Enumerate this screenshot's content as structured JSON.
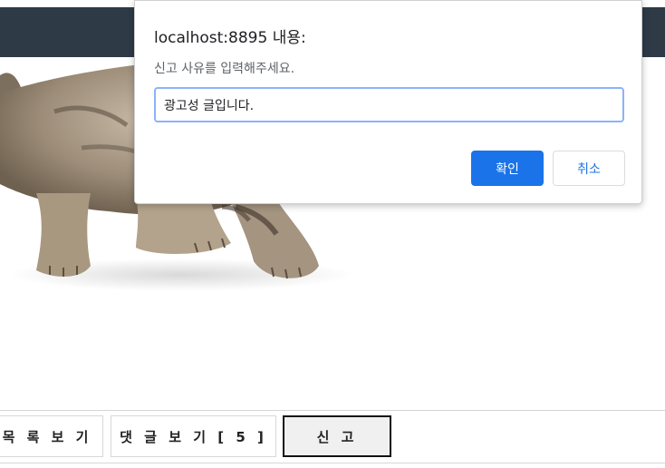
{
  "dialog": {
    "title": "localhost:8895 내용:",
    "message": "신고 사유를 입력해주세요.",
    "input_value": "광고성 글입니다.",
    "ok_label": "확인",
    "cancel_label": "취소"
  },
  "buttons": {
    "list_label": "목 록 보 기",
    "comment_label": "댓 글 보 기 [ 5 ]",
    "report_label": "신 고"
  },
  "colors": {
    "topbar": "#2e3a46",
    "primary": "#1a73e8",
    "input_focus": "#8ab4f8"
  }
}
